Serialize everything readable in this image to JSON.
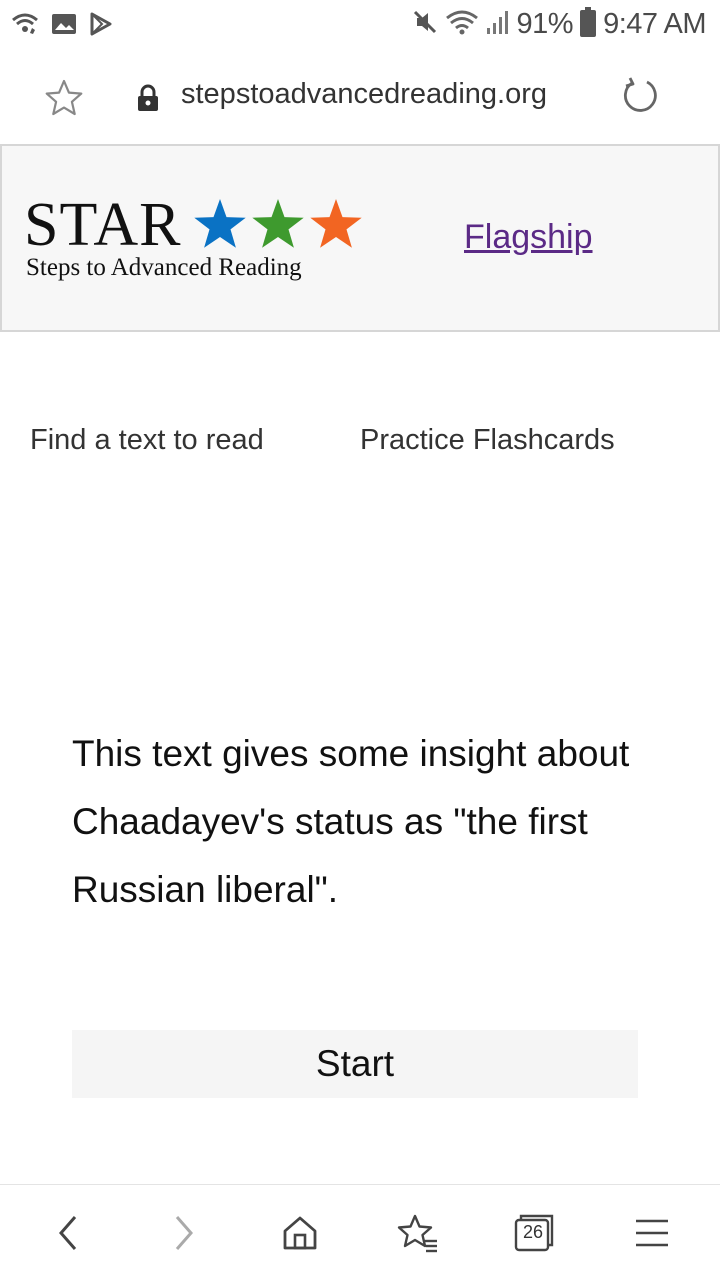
{
  "status_bar": {
    "battery": "91%",
    "time": "9:47 AM",
    "left_icons": [
      "wifi-call-icon",
      "image-icon",
      "play-store-icon"
    ],
    "right_icons": [
      "mute-icon",
      "wifi-icon",
      "signal-icon",
      "battery-icon"
    ]
  },
  "browser": {
    "url": "stepstoadvancedreading.org",
    "icons": [
      "star-icon",
      "lock-icon",
      "reload-icon"
    ]
  },
  "header": {
    "logo_word": "STAR",
    "logo_tagline": "Steps to Advanced Reading",
    "logo_star_colors": [
      "#0a72c4",
      "#3e9a2e",
      "#f26522"
    ],
    "flagship_link": "Flagship",
    "link_color": "#5b2a86"
  },
  "nav": {
    "find_text": "Find a text to read",
    "practice_flashcards": "Practice Flashcards"
  },
  "main": {
    "description": "This text gives some insight about Chaadayev's status as \"the first Russian liberal\".",
    "start_label": "Start"
  },
  "bottom_bar": {
    "tabs_count": "26",
    "icons": [
      "back-icon",
      "forward-icon",
      "home-icon",
      "bookmarks-icon",
      "tabs-icon",
      "menu-icon"
    ]
  }
}
